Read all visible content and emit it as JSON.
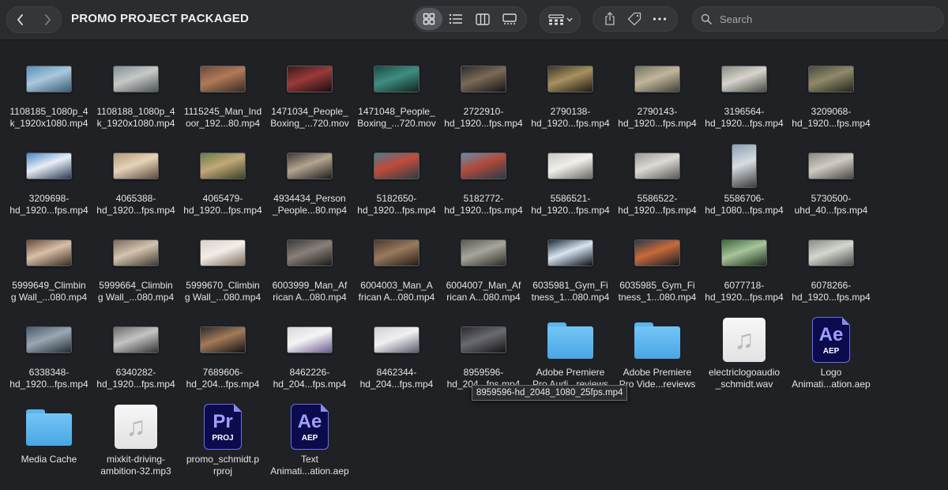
{
  "window": {
    "title": "PROMO PROJECT PACKAGED"
  },
  "search": {
    "placeholder": "Search"
  },
  "tooltip": "8959596-hd_2048_1080_25fps.mp4",
  "colors": {
    "background": "#1f2124",
    "toolbar": "#2a2c30",
    "folder": "#5bb4ec",
    "accent_app": "#0b0b4d"
  },
  "items": [
    {
      "kind": "video",
      "l1": "1108185_1080p_4",
      "l2": "k_1920x1080.mp4",
      "thumb": [
        "#5a8fb8",
        "#a9c8dd",
        "#3b5b72"
      ]
    },
    {
      "kind": "video",
      "l1": "1108188_1080p_4",
      "l2": "k_1920x1080.mp4",
      "thumb": [
        "#7f8f9a",
        "#c7c9c6",
        "#4d5458"
      ]
    },
    {
      "kind": "video",
      "l1": "1115245_Man_Ind",
      "l2": "oor_192...80.mp4",
      "thumb": [
        "#6a4a3a",
        "#b07a58",
        "#3a2a22"
      ]
    },
    {
      "kind": "video",
      "l1": "1471034_People_",
      "l2": "Boxing_...720.mov",
      "thumb": [
        "#3a1a1a",
        "#9a3a3a",
        "#1a0d0d"
      ]
    },
    {
      "kind": "video",
      "l1": "1471048_People_",
      "l2": "Boxing_...720.mov",
      "thumb": [
        "#1b4a44",
        "#3e8f80",
        "#0f2522"
      ]
    },
    {
      "kind": "video",
      "l1": "2722910-",
      "l2": "hd_1920...fps.mp4",
      "thumb": [
        "#2a2a2a",
        "#7b6a56",
        "#141414"
      ]
    },
    {
      "kind": "video",
      "l1": "2790138-",
      "l2": "hd_1920...fps.mp4",
      "thumb": [
        "#3a3528",
        "#a8915f",
        "#1e1b14"
      ]
    },
    {
      "kind": "video",
      "l1": "2790143-",
      "l2": "hd_1920...fps.mp4",
      "thumb": [
        "#6d7561",
        "#c3b59c",
        "#3d4237"
      ]
    },
    {
      "kind": "video",
      "l1": "3196564-",
      "l2": "hd_1920...fps.mp4",
      "thumb": [
        "#8a8a84",
        "#d6d4cc",
        "#4a4a46"
      ]
    },
    {
      "kind": "video",
      "l1": "3209068-",
      "l2": "hd_1920...fps.mp4",
      "thumb": [
        "#4a4a3a",
        "#8f8a6a",
        "#24241c"
      ]
    },
    {
      "kind": "video",
      "l1": "3209698-",
      "l2": "hd_1920...fps.mp4",
      "thumb": [
        "#4a8ac8",
        "#e8eef4",
        "#2a3a55"
      ]
    },
    {
      "kind": "video",
      "l1": "4065388-",
      "l2": "hd_1920...fps.mp4",
      "thumb": [
        "#b49a7a",
        "#e6d3b8",
        "#5a4a3a"
      ]
    },
    {
      "kind": "video",
      "l1": "4065479-",
      "l2": "hd_1920...fps.mp4",
      "thumb": [
        "#6b7a4a",
        "#c2a878",
        "#3a4228"
      ]
    },
    {
      "kind": "video",
      "l1": "4934434_Person",
      "l2": "_People...80.mp4",
      "thumb": [
        "#3c3a36",
        "#b4a490",
        "#1e1d1b"
      ]
    },
    {
      "kind": "video",
      "l1": "5182650-",
      "l2": "hd_1920...fps.mp4",
      "thumb": [
        "#4a7a8a",
        "#c24a3a",
        "#2a3e44"
      ]
    },
    {
      "kind": "video",
      "l1": "5182772-",
      "l2": "hd_1920...fps.mp4",
      "thumb": [
        "#6a8aa8",
        "#b04a3a",
        "#2a3a4a"
      ]
    },
    {
      "kind": "video",
      "l1": "5586521-",
      "l2": "hd_1920...fps.mp4",
      "thumb": [
        "#c8c6c0",
        "#f0efea",
        "#6a6864"
      ]
    },
    {
      "kind": "video",
      "l1": "5586522-",
      "l2": "hd_1920...fps.mp4",
      "thumb": [
        "#9a9894",
        "#dcdad4",
        "#5a5854"
      ]
    },
    {
      "kind": "video",
      "l1": "5586706-",
      "l2": "hd_1080...fps.mp4",
      "thumb": [
        "#8aa0b4",
        "#d8dde0",
        "#3a3a3a"
      ],
      "portrait": true
    },
    {
      "kind": "video",
      "l1": "5730500-",
      "l2": "uhd_40...fps.mp4",
      "thumb": [
        "#8a8884",
        "#d0ccc4",
        "#4a4844"
      ]
    },
    {
      "kind": "video",
      "l1": "5999649_Climbin",
      "l2": "g Wall_...080.mp4",
      "thumb": [
        "#6a4a3a",
        "#d8c0a8",
        "#3a2a22"
      ]
    },
    {
      "kind": "video",
      "l1": "5999664_Climbin",
      "l2": "g Wall_...080.mp4",
      "thumb": [
        "#7a6a5a",
        "#d4c4b0",
        "#3e362e"
      ]
    },
    {
      "kind": "video",
      "l1": "5999670_Climbin",
      "l2": "g Wall_...080.mp4",
      "thumb": [
        "#d8d0c8",
        "#f2ede6",
        "#7a6a5a"
      ]
    },
    {
      "kind": "video",
      "l1": "6003999_Man_Af",
      "l2": "rican A...080.mp4",
      "thumb": [
        "#3a3a3a",
        "#8a8078",
        "#1a1a1a"
      ]
    },
    {
      "kind": "video",
      "l1": "6004003_Man_A",
      "l2": "frican A...080.mp4",
      "thumb": [
        "#4a3a2e",
        "#9a7a5e",
        "#241c16"
      ]
    },
    {
      "kind": "video",
      "l1": "6004007_Man_Af",
      "l2": "rican A...080.mp4",
      "thumb": [
        "#5a5a52",
        "#a8a69a",
        "#2a2a26"
      ]
    },
    {
      "kind": "video",
      "l1": "6035981_Gym_Fi",
      "l2": "tness_1...080.mp4",
      "thumb": [
        "#1a2a3a",
        "#d8e4f0",
        "#0a1018"
      ]
    },
    {
      "kind": "video",
      "l1": "6035985_Gym_Fi",
      "l2": "tness_1...080.mp4",
      "thumb": [
        "#2a3a4a",
        "#c86a3a",
        "#141c24"
      ]
    },
    {
      "kind": "video",
      "l1": "6077718-",
      "l2": "hd_1920...fps.mp4",
      "thumb": [
        "#3a6a3a",
        "#a8c49a",
        "#1a2e1a"
      ]
    },
    {
      "kind": "video",
      "l1": "6078266-",
      "l2": "hd_1920...fps.mp4",
      "thumb": [
        "#8a8c88",
        "#d4d6d0",
        "#4a4c48"
      ]
    },
    {
      "kind": "video",
      "l1": "6338348-",
      "l2": "hd_1920...fps.mp4",
      "thumb": [
        "#4a5a6a",
        "#9aa8b4",
        "#242c34"
      ]
    },
    {
      "kind": "video",
      "l1": "6340282-",
      "l2": "hd_1920...fps.mp4",
      "thumb": [
        "#6a6a6a",
        "#c4c4c4",
        "#343434"
      ]
    },
    {
      "kind": "video",
      "l1": "7689606-",
      "l2": "hd_204...fps.mp4",
      "thumb": [
        "#2a2a2a",
        "#a47a5a",
        "#121212"
      ]
    },
    {
      "kind": "video",
      "l1": "8462226-",
      "l2": "hd_204...fps.mp4",
      "thumb": [
        "#d8d8dc",
        "#f4f4f6",
        "#6a5a8a"
      ]
    },
    {
      "kind": "video",
      "l1": "8462344-",
      "l2": "hd_204...fps.mp4",
      "thumb": [
        "#d0d0d4",
        "#f0f0f2",
        "#5a5a6a"
      ]
    },
    {
      "kind": "video",
      "l1": "8959596-",
      "l2": "hd_204...fps.mp4",
      "thumb": [
        "#2a2a2e",
        "#6a6a72",
        "#141416"
      ]
    },
    {
      "kind": "folder",
      "l1": "Adobe Premiere",
      "l2": "Pro Audi...reviews"
    },
    {
      "kind": "folder",
      "l1": "Adobe Premiere",
      "l2": "Pro Vide...reviews"
    },
    {
      "kind": "audio",
      "l1": "electriclogoaudio",
      "l2": "_schmidt.wav"
    },
    {
      "kind": "ae",
      "l1": "Logo",
      "l2": "Animati...ation.aep",
      "badge": "Ae",
      "sub": "AEP"
    },
    {
      "kind": "folder",
      "l1": "Media Cache",
      "l2": ""
    },
    {
      "kind": "audio",
      "l1": "mixkit-driving-",
      "l2": "ambition-32.mp3"
    },
    {
      "kind": "pr",
      "l1": "promo_schmidt.p",
      "l2": "rproj",
      "badge": "Pr",
      "sub": "PROJ"
    },
    {
      "kind": "ae",
      "l1": "Text",
      "l2": "Animati...ation.aep",
      "badge": "Ae",
      "sub": "AEP"
    }
  ]
}
